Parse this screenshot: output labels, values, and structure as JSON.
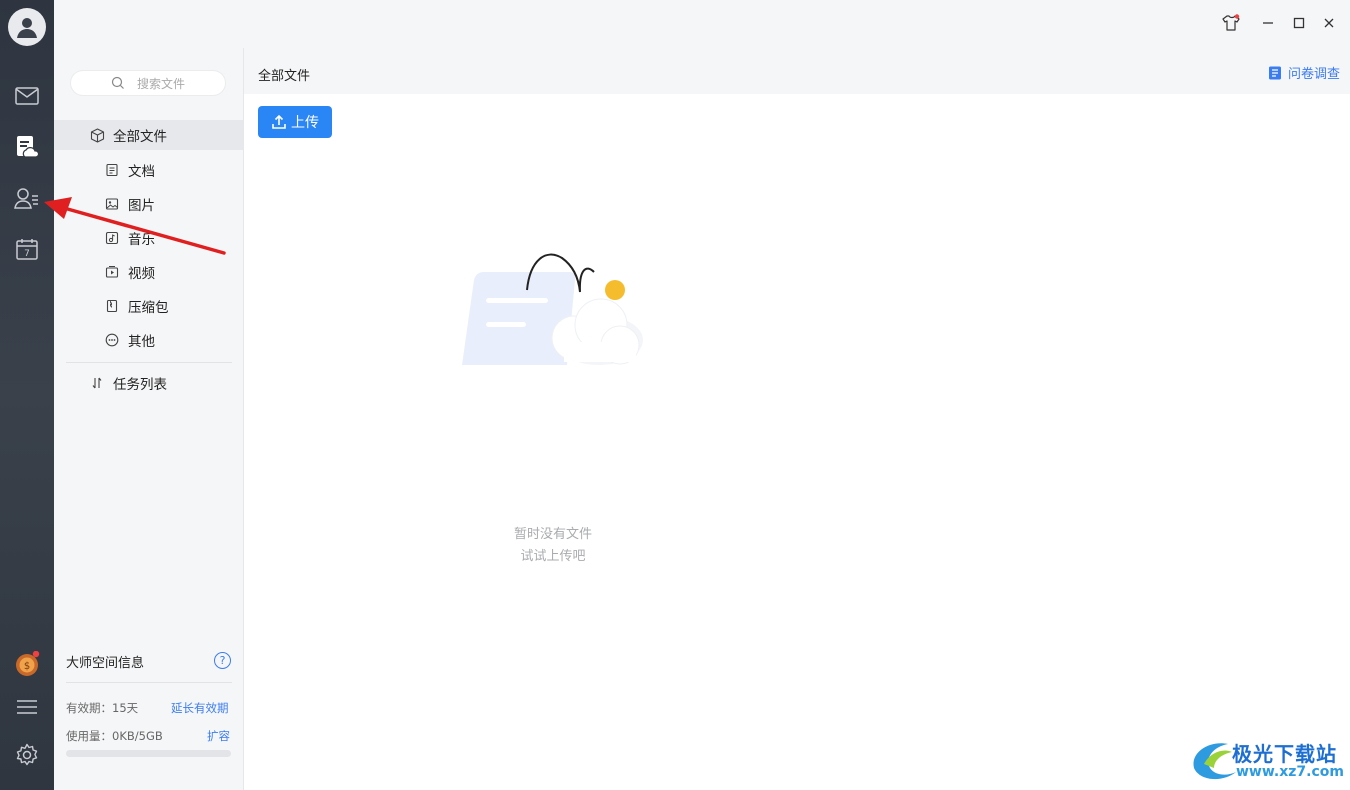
{
  "rail": {
    "icons": [
      "avatar-icon",
      "mail-icon",
      "cloud-file-icon",
      "contacts-icon",
      "calendar-icon",
      "vip-coin-icon",
      "menu-icon",
      "settings-icon"
    ],
    "calendar_day": "7"
  },
  "sidebar": {
    "search_placeholder": "搜索文件",
    "all_files": "全部文件",
    "items": [
      {
        "label": "文档",
        "icon": "document-icon"
      },
      {
        "label": "图片",
        "icon": "image-icon"
      },
      {
        "label": "音乐",
        "icon": "music-icon"
      },
      {
        "label": "视频",
        "icon": "video-icon"
      },
      {
        "label": "压缩包",
        "icon": "archive-icon"
      },
      {
        "label": "其他",
        "icon": "more-icon"
      }
    ],
    "task_list": "任务列表",
    "storage": {
      "title": "大师空间信息",
      "help": "?",
      "validity_label": "有效期：15天",
      "extend_link": "延长有效期",
      "usage_label": "使用量：0KB/5GB",
      "expand_link": "扩容",
      "usage_fraction": 0
    }
  },
  "main": {
    "title": "全部文件",
    "survey": "问卷调查",
    "upload": "上传",
    "empty_line1": "暂时没有文件",
    "empty_line2": "试试上传吧"
  },
  "watermark": {
    "line1": "极光下载站",
    "line2": "www.xz7.com"
  },
  "colors": {
    "accent": "#2b86f5",
    "link": "#3b7cf2",
    "rail": "#323943",
    "annotation_arrow": "#e02020"
  }
}
